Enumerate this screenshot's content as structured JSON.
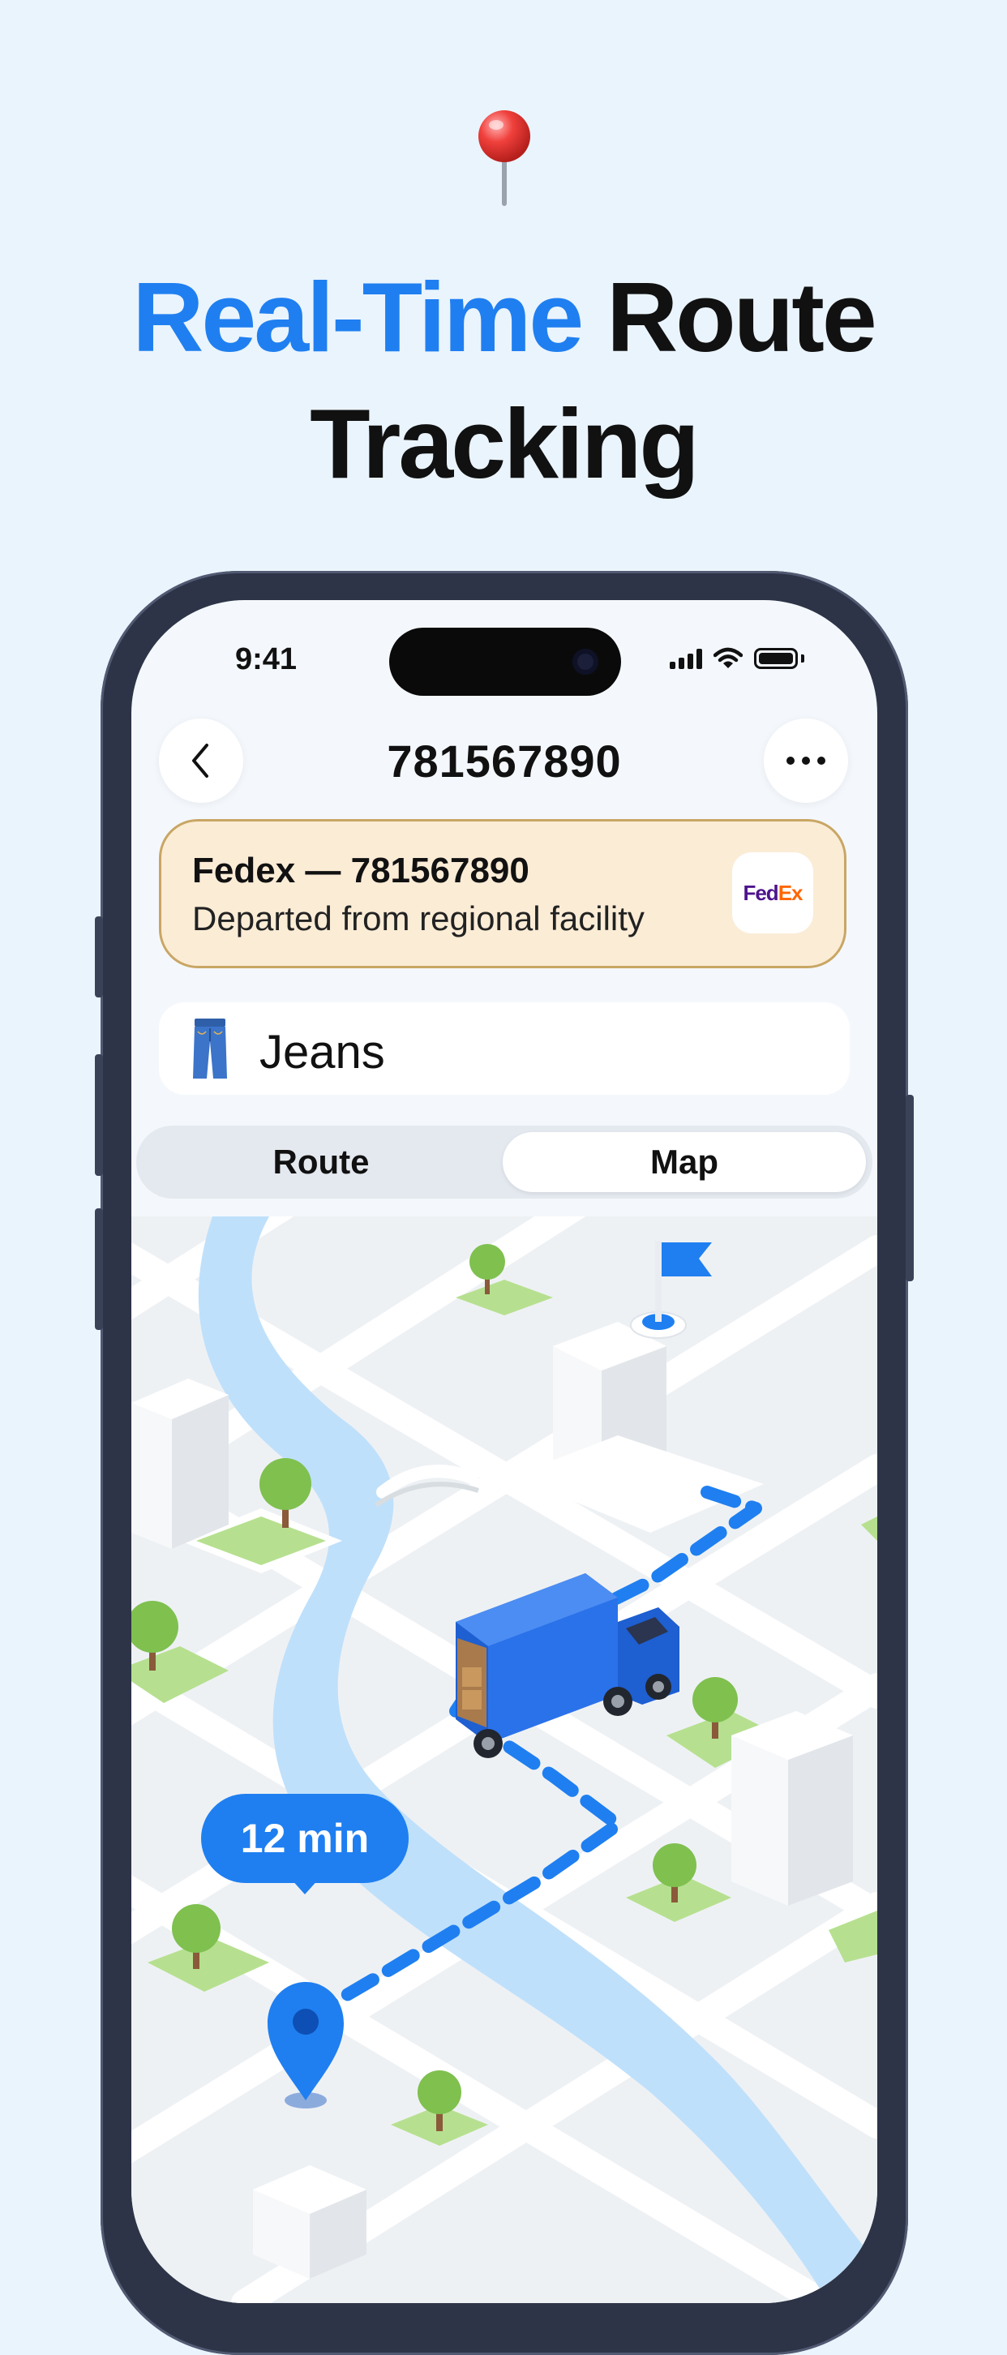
{
  "headline": {
    "accent": "Real-Time",
    "line1_rest": " Route",
    "line2": "Tracking"
  },
  "status_bar": {
    "time": "9:41"
  },
  "nav": {
    "title": "781567890",
    "back_icon": "chevron-left-icon",
    "more_icon": "ellipsis-icon"
  },
  "carrier": {
    "title": "Fedex — 781567890",
    "status": "Departed from regional facility",
    "logo_fed": "Fed",
    "logo_ex": "Ex"
  },
  "item": {
    "icon": "jeans-icon",
    "label": "Jeans"
  },
  "segmented": {
    "route": "Route",
    "map": "Map",
    "selected": "Map"
  },
  "map": {
    "eta": "12 min"
  },
  "colors": {
    "accent": "#1f7ff0",
    "card_bg": "#fbecd6",
    "card_border": "#c9a664",
    "page_bg": "#eaf4fd"
  }
}
